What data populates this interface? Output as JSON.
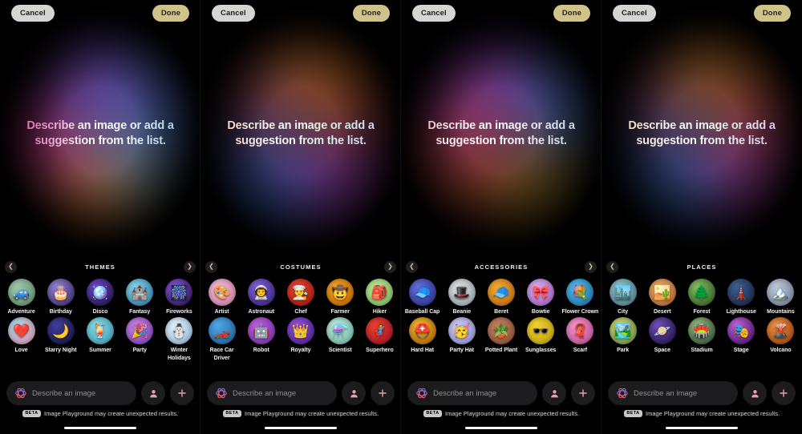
{
  "panels": [
    {
      "id": "themes-panel",
      "topbar": {
        "cancel_label": "Cancel",
        "done_label": "Done"
      },
      "headline": "Describe an image or add a suggestion from the list.",
      "section": {
        "title": "THEMES",
        "prev_icon": "chevron-left-icon",
        "next_icon": "chevron-right-icon",
        "has_prev": true,
        "has_next": true,
        "items": [
          {
            "label": "Adventure",
            "glyph": "🚙",
            "c1": "#9fc6a8",
            "c2": "#5f8c6e"
          },
          {
            "label": "Birthday",
            "glyph": "🎂",
            "c1": "#8f7ecf",
            "c2": "#3b2a6b"
          },
          {
            "label": "Disco",
            "glyph": "🪩",
            "c1": "#6d46c8",
            "c2": "#1c1040"
          },
          {
            "label": "Fantasy",
            "glyph": "🏰",
            "c1": "#7fd0e8",
            "c2": "#2f7fa8"
          },
          {
            "label": "Fireworks",
            "glyph": "🎆",
            "c1": "#8a4fd8",
            "c2": "#2a1250"
          },
          {
            "label": "Love",
            "glyph": "❤️",
            "c1": "#9fd8e8",
            "c2": "#e88fb0"
          },
          {
            "label": "Starry Night",
            "glyph": "🌙",
            "c1": "#3f3f9b",
            "c2": "#12123a"
          },
          {
            "label": "Summer",
            "glyph": "🍹",
            "c1": "#7fd8e0",
            "c2": "#3f9fb8"
          },
          {
            "label": "Party",
            "glyph": "🎉",
            "c1": "#c47fe8",
            "c2": "#7a3fb0"
          },
          {
            "label": "Winter Holidays",
            "glyph": "⛄",
            "c1": "#dfeef8",
            "c2": "#8fb8d8"
          }
        ]
      },
      "input": {
        "icon": "image-playground-icon",
        "placeholder": "Describe an image",
        "person_icon": "person-icon",
        "add_icon": "plus-icon"
      },
      "disclaimer": {
        "badge": "BETA",
        "text": "Image Playground may create unexpected results."
      }
    },
    {
      "id": "costumes-panel",
      "topbar": {
        "cancel_label": "Cancel",
        "done_label": "Done"
      },
      "headline": "Describe an image or add a suggestion from the list.",
      "section": {
        "title": "COSTUMES",
        "prev_icon": "chevron-left-icon",
        "next_icon": "chevron-right-icon",
        "has_prev": true,
        "has_next": true,
        "items": [
          {
            "label": "Artist",
            "glyph": "🎨",
            "c1": "#f0b8d0",
            "c2": "#d07fa8"
          },
          {
            "label": "Astronaut",
            "glyph": "👨‍🚀",
            "c1": "#7f5fd8",
            "c2": "#3a2080"
          },
          {
            "label": "Chef",
            "glyph": "👨‍🍳",
            "c1": "#e8402f",
            "c2": "#a01810"
          },
          {
            "label": "Farmer",
            "glyph": "🤠",
            "c1": "#f0a020",
            "c2": "#c06800"
          },
          {
            "label": "Hiker",
            "glyph": "🎒",
            "c1": "#b8e890",
            "c2": "#7fb85f"
          },
          {
            "label": "Race Car Driver",
            "glyph": "🏎️",
            "c1": "#4fa8e8",
            "c2": "#1f5f9b"
          },
          {
            "label": "Robot",
            "glyph": "🤖",
            "c1": "#b85fd8",
            "c2": "#7a2fa8"
          },
          {
            "label": "Royalty",
            "glyph": "👑",
            "c1": "#8f4fd8",
            "c2": "#4f1f8f"
          },
          {
            "label": "Scientist",
            "glyph": "⚗️",
            "c1": "#b8e8d8",
            "c2": "#6fb8a8"
          },
          {
            "label": "Superhero",
            "glyph": "🦸",
            "c1": "#e8402f",
            "c2": "#a01020"
          }
        ]
      },
      "input": {
        "icon": "image-playground-icon",
        "placeholder": "Describe an image",
        "person_icon": "person-icon",
        "add_icon": "plus-icon"
      },
      "disclaimer": {
        "badge": "BETA",
        "text": "Image Playground may create unexpected results."
      }
    },
    {
      "id": "accessories-panel",
      "topbar": {
        "cancel_label": "Cancel",
        "done_label": "Done"
      },
      "headline": "Describe an image or add a suggestion from the list.",
      "section": {
        "title": "ACCESSORIES",
        "prev_icon": "chevron-left-icon",
        "next_icon": "chevron-right-icon",
        "has_prev": true,
        "has_next": true,
        "items": [
          {
            "label": "Baseball Cap",
            "glyph": "🧢",
            "c1": "#5f6fd8",
            "c2": "#2a2f8f"
          },
          {
            "label": "Beanie",
            "glyph": "🎩",
            "c1": "#d8dde2",
            "c2": "#9aa3ab"
          },
          {
            "label": "Beret",
            "glyph": "🧢",
            "c1": "#f0a830",
            "c2": "#c06810"
          },
          {
            "label": "Bowtie",
            "glyph": "🎀",
            "c1": "#d8a8e8",
            "c2": "#a05fc0"
          },
          {
            "label": "Flower Crown",
            "glyph": "💐",
            "c1": "#4fb8e8",
            "c2": "#1f6fa8"
          },
          {
            "label": "Hard Hat",
            "glyph": "⛑️",
            "c1": "#f0b030",
            "c2": "#b06800"
          },
          {
            "label": "Party Hat",
            "glyph": "🥳",
            "c1": "#c8c8f0",
            "c2": "#8f8fd0"
          },
          {
            "label": "Potted Plant",
            "glyph": "🪴",
            "c1": "#c07f5f",
            "c2": "#8f4f30"
          },
          {
            "label": "Sunglasses",
            "glyph": "🕶️",
            "c1": "#f0d030",
            "c2": "#c0a010"
          },
          {
            "label": "Scarf",
            "glyph": "🧣",
            "c1": "#f090c8",
            "c2": "#c05098"
          }
        ]
      },
      "input": {
        "icon": "image-playground-icon",
        "placeholder": "Describe an image",
        "person_icon": "person-icon",
        "add_icon": "plus-icon"
      },
      "disclaimer": {
        "badge": "BETA",
        "text": "Image Playground may create unexpected results."
      }
    },
    {
      "id": "places-panel",
      "topbar": {
        "cancel_label": "Cancel",
        "done_label": "Done"
      },
      "headline": "Describe an image or add a suggestion from the list.",
      "section": {
        "title": "PLACES",
        "prev_icon": "chevron-left-icon",
        "next_icon": "chevron-right-icon",
        "has_prev": true,
        "has_next": false,
        "items": [
          {
            "label": "City",
            "glyph": "🏙️",
            "c1": "#8fc0c8",
            "c2": "#4f7f8f"
          },
          {
            "label": "Desert",
            "glyph": "🏜️",
            "c1": "#e8a860",
            "c2": "#b06830"
          },
          {
            "label": "Forest",
            "glyph": "🌲",
            "c1": "#7fb85f",
            "c2": "#2f5f28"
          },
          {
            "label": "Lighthouse",
            "glyph": "🗼",
            "c1": "#3f5f8f",
            "c2": "#15203f"
          },
          {
            "label": "Mountains",
            "glyph": "🏔️",
            "c1": "#b8c8d8",
            "c2": "#6f7f9b"
          },
          {
            "label": "Park",
            "glyph": "🏞️",
            "c1": "#c8d870",
            "c2": "#6f8f3f"
          },
          {
            "label": "Space",
            "glyph": "🪐",
            "c1": "#6f4fb8",
            "c2": "#1a1040"
          },
          {
            "label": "Stadium",
            "glyph": "🏟️",
            "c1": "#8fb870",
            "c2": "#2f4f3f"
          },
          {
            "label": "Stage",
            "glyph": "🎭",
            "c1": "#c05fd8",
            "c2": "#401060"
          },
          {
            "label": "Volcano",
            "glyph": "🌋",
            "c1": "#e88f40",
            "c2": "#a04010"
          }
        ]
      },
      "input": {
        "icon": "image-playground-icon",
        "placeholder": "Describe an image",
        "person_icon": "person-icon",
        "add_icon": "plus-icon"
      },
      "disclaimer": {
        "badge": "BETA",
        "text": "Image Playground may create unexpected results."
      }
    }
  ],
  "colors": {
    "cancel_pill": "#d7d5d2",
    "done_pill": "#cfc38a",
    "chevron": "#cfc08a",
    "background": "#000000",
    "field": "#1c1c1e",
    "placeholder_text": "#8e8e93",
    "accent_pink": "#e9a0a8"
  }
}
